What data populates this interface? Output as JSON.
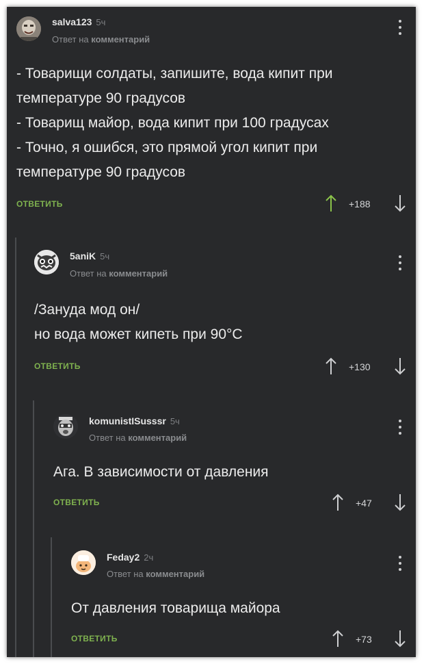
{
  "comments": [
    {
      "username": "salva123",
      "time": "5ч",
      "reply_prefix": "Ответ на",
      "reply_target": "комментарий",
      "lines": [
        "- Товарищи солдаты, запишите, вода кипит при",
        "температуре 90 градусов",
        "- Товарищ майор, вода кипит при 100 градусах",
        "- Точно, я ошибся, это прямой угол кипит при",
        "температуре 90 градусов"
      ],
      "reply_label": "ОТВЕТИТЬ",
      "score": "+188",
      "upvote_color": "#8bc34a"
    },
    {
      "username": "5aniK",
      "time": "5ч",
      "reply_prefix": "Ответ на",
      "reply_target": "комментарий",
      "lines": [
        "/Зануда мод он/",
        "но вода может кипеть при 90°С"
      ],
      "reply_label": "ОТВЕТИТЬ",
      "score": "+130"
    },
    {
      "username": "komunistISusssr",
      "time": "5ч",
      "reply_prefix": "Ответ на",
      "reply_target": "комментарий",
      "lines": [
        "Ага. В зависимости от давления"
      ],
      "reply_label": "ОТВЕТИТЬ",
      "score": "+47"
    },
    {
      "username": "Feday2",
      "time": "2ч",
      "reply_prefix": "Ответ на",
      "reply_target": "комментарий",
      "lines": [
        "От давления товарища майора"
      ],
      "reply_label": "ОТВЕТИТЬ",
      "score": "+73"
    }
  ],
  "colors": {
    "background": "#28292b",
    "text": "#ececec",
    "reply_button": "#7fb24f",
    "muted": "#8a8c8f",
    "thread_line": "#4a4c4f"
  }
}
